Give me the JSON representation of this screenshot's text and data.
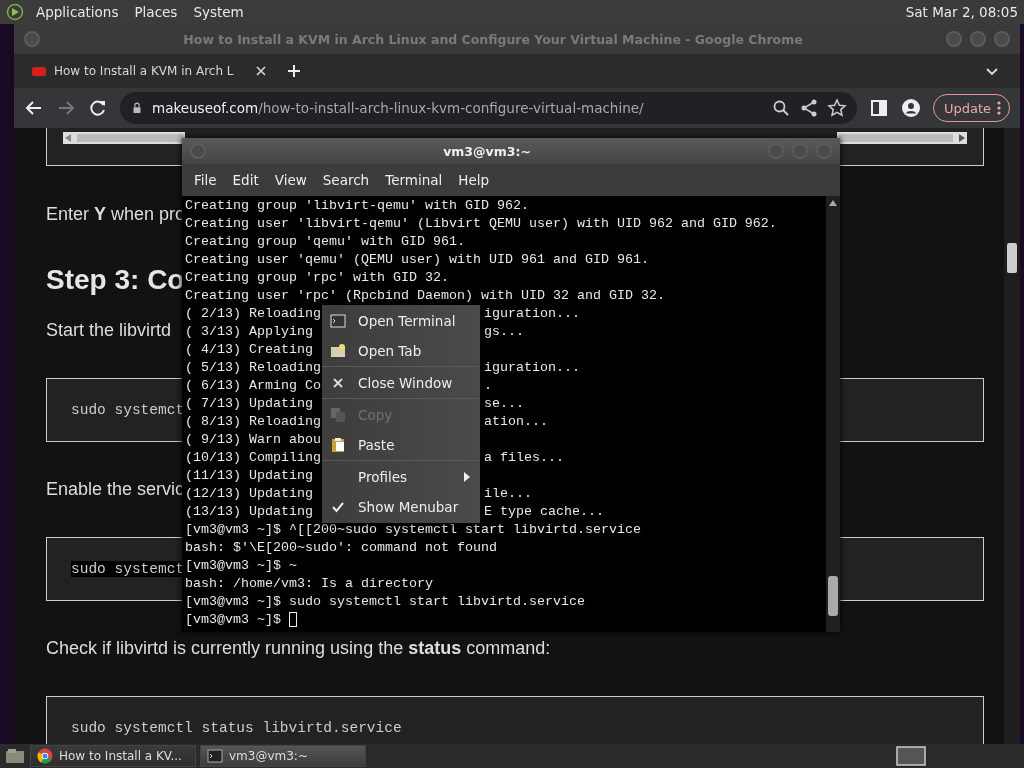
{
  "top_panel": {
    "menus": [
      "Applications",
      "Places",
      "System"
    ],
    "clock": "Sat Mar 2, 08:05"
  },
  "browser": {
    "window_title": "How to Install a KVM in Arch Linux and Configure Your Virtual Machine - Google Chrome",
    "tabs": [
      {
        "title": "How to Install a KVM in Arch L",
        "selected": true
      }
    ],
    "url": {
      "host": "makeuseof.com",
      "path": "/how-to-install-arch-linux-kvm-configure-virtual-machine/"
    },
    "update_button": "Update",
    "article": [
      {
        "kind": "code-end"
      },
      {
        "kind": "paragraph",
        "text": "Enter **Y** when pro"
      },
      {
        "kind": "heading",
        "text": "Step 3: Co"
      },
      {
        "kind": "paragraph",
        "text": "Start the libvirtd"
      },
      {
        "kind": "code",
        "text": "sudo systemct",
        "highlighted": false
      },
      {
        "kind": "paragraph",
        "text": "Enable the servic"
      },
      {
        "kind": "code",
        "text": "sudo systemct",
        "highlighted": true
      },
      {
        "kind": "paragraph",
        "text": "Check if libvirtd is currently running using the **status** command:"
      },
      {
        "kind": "code",
        "text": "sudo systemctl status libvirtd.service",
        "highlighted": false
      }
    ]
  },
  "terminal": {
    "title": "vm3@vm3:~",
    "menus": [
      "File",
      "Edit",
      "View",
      "Search",
      "Terminal",
      "Help"
    ],
    "lines": [
      {
        "text": "Creating group 'libvirt-qemu' with GID 962."
      },
      {
        "text": "Creating user 'libvirt-qemu' (Libvirt QEMU user) with UID 962 and GID 962."
      },
      {
        "text": "Creating group 'qemu' with GID 961."
      },
      {
        "text": "Creating user 'qemu' (QEMU user) with UID 961 and GID 961."
      },
      {
        "text": "Creating group 'rpc' with GID 32."
      },
      {
        "text": "Creating user 'rpc' (Rpcbind Daemon) with UID 32 and GID 32."
      },
      {
        "text": "( 2/13) Reloading",
        "right": "iguration..."
      },
      {
        "text": "( 3/13) Applying",
        "right": "gs..."
      },
      {
        "text": "( 4/13) Creating"
      },
      {
        "text": "( 5/13) Reloading",
        "right": "iguration..."
      },
      {
        "text": "( 6/13) Arming Co",
        "right": "."
      },
      {
        "text": "( 7/13) Updating",
        "right": "se..."
      },
      {
        "text": "( 8/13) Reloading",
        "right": "ation..."
      },
      {
        "text": "( 9/13) Warn abou"
      },
      {
        "text": "(10/13) Compiling",
        "right": "a files..."
      },
      {
        "text": "(11/13) Updating"
      },
      {
        "text": "(12/13) Updating",
        "right": "ile..."
      },
      {
        "text": "(13/13) Updating",
        "right": "E type cache..."
      },
      {
        "text": "[vm3@vm3 ~]$ ^[[200~sudo systemctl start libvirtd.service"
      },
      {
        "text": "bash: $'\\E[200~sudo': command not found"
      },
      {
        "text": "[vm3@vm3 ~]$ ~"
      },
      {
        "text": "bash: /home/vm3: Is a directory"
      },
      {
        "text": "[vm3@vm3 ~]$ sudo systemctl start libvirtd.service"
      },
      {
        "text": "[vm3@vm3 ~]$ ",
        "cursor": true
      }
    ]
  },
  "context_menu": [
    {
      "label": "Open Terminal",
      "kind": "terminal",
      "disabled": false,
      "checked": false,
      "submenu": false,
      "separator_after": false
    },
    {
      "label": "Open Tab",
      "kind": "tab",
      "disabled": false,
      "checked": false,
      "submenu": false,
      "separator_after": true
    },
    {
      "label": "Close Window",
      "kind": "close",
      "disabled": false,
      "checked": false,
      "submenu": false,
      "separator_after": true
    },
    {
      "label": "Copy",
      "kind": "copy",
      "disabled": true,
      "checked": false,
      "submenu": false,
      "separator_after": false
    },
    {
      "label": "Paste",
      "kind": "paste",
      "disabled": false,
      "checked": false,
      "submenu": false,
      "separator_after": true
    },
    {
      "label": "Profiles",
      "kind": "plain",
      "disabled": false,
      "checked": false,
      "submenu": true,
      "separator_after": false
    },
    {
      "label": "Show Menubar",
      "kind": "check",
      "disabled": false,
      "checked": true,
      "submenu": false,
      "separator_after": false
    }
  ],
  "taskbar": [
    {
      "label": "How to Install a KV...",
      "kind": "browser",
      "selected": false
    },
    {
      "label": "vm3@vm3:~",
      "kind": "terminal",
      "selected": true
    }
  ]
}
